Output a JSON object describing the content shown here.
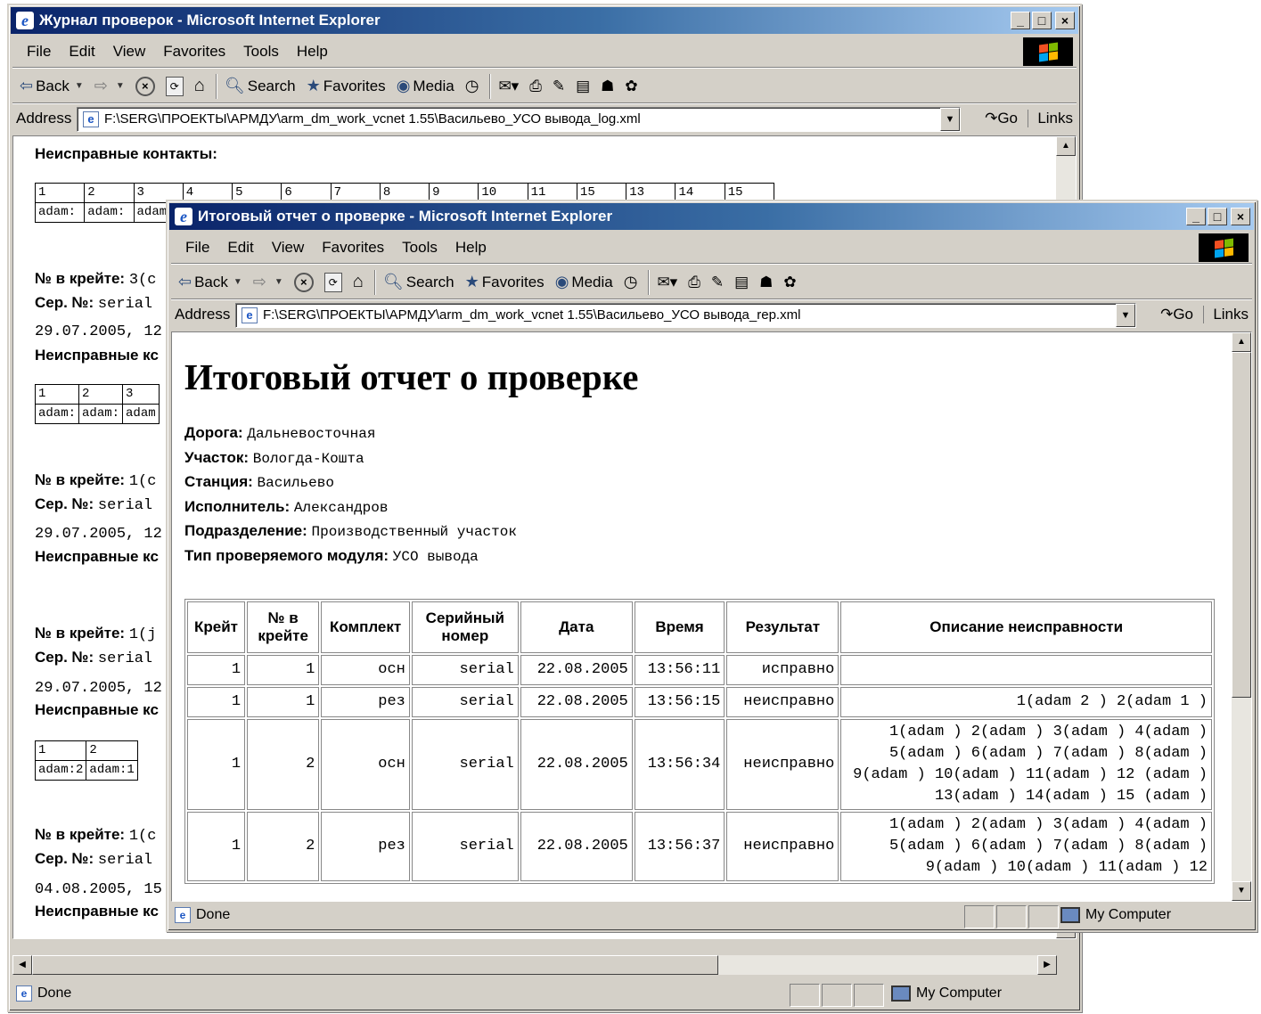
{
  "back_window": {
    "title": "Журнал проверок - Microsoft Internet Explorer",
    "menu": [
      "File",
      "Edit",
      "View",
      "Favorites",
      "Tools",
      "Help"
    ],
    "toolbar": {
      "back": "Back",
      "search": "Search",
      "favorites": "Favorites",
      "media": "Media"
    },
    "address_label": "Address",
    "address": "F:\\SERG\\ПРОЕКТЫ\\АРМДУ\\arm_dm_work_vcnet 1.55\\Васильево_УСО вывода_log.xml",
    "go": "Go",
    "links": "Links",
    "status": "Done",
    "zone": "My Computer",
    "log": {
      "faulty_label": "Неисправные контакты:",
      "first_table": {
        "nums": [
          "1",
          "2",
          "3",
          "4",
          "5",
          "6",
          "7",
          "8",
          "9",
          "10",
          "11",
          "15",
          "13",
          "14",
          "15"
        ],
        "vals": [
          "adam:",
          "adam:",
          "adam"
        ]
      },
      "blocks": [
        {
          "slot": "№ в крейте:",
          "slot_val": "3(c",
          "serial": "Сер. №:",
          "serial_val": "serial",
          "date": "29.07.2005, 12",
          "faulty": "Неисправные кс",
          "nums": [
            "1",
            "2",
            "3"
          ],
          "vals": [
            "adam:",
            "adam:",
            "adam"
          ]
        },
        {
          "slot": "№ в крейте:",
          "slot_val": "1(c",
          "serial": "Сер. №:",
          "serial_val": "serial",
          "date": "29.07.2005, 12",
          "faulty": "Неисправные кс"
        },
        {
          "slot": "№ в крейте:",
          "slot_val": "1(j",
          "serial": "Сер. №:",
          "serial_val": "serial",
          "date": "29.07.2005, 12",
          "faulty": "Неисправные кс",
          "nums": [
            "1",
            "2"
          ],
          "vals": [
            "adam:2",
            "adam:1"
          ]
        },
        {
          "slot": "№ в крейте:",
          "slot_val": "1(c",
          "serial": "Сер. №:",
          "serial_val": "serial",
          "date": "04.08.2005, 15",
          "faulty": "Неисправные кс"
        }
      ]
    }
  },
  "front_window": {
    "title": "Итоговый отчет о проверке - Microsoft Internet Explorer",
    "menu": [
      "File",
      "Edit",
      "View",
      "Favorites",
      "Tools",
      "Help"
    ],
    "toolbar": {
      "back": "Back",
      "search": "Search",
      "favorites": "Favorites",
      "media": "Media"
    },
    "address_label": "Address",
    "address": "F:\\SERG\\ПРОЕКТЫ\\АРМДУ\\arm_dm_work_vcnet 1.55\\Васильево_УСО вывода_rep.xml",
    "go": "Go",
    "links": "Links",
    "status": "Done",
    "zone": "My Computer",
    "report": {
      "heading": "Итоговый отчет о проверке",
      "meta": [
        {
          "key": "Дорога:",
          "value": "Дальневосточная"
        },
        {
          "key": "Участок:",
          "value": "Вологда-Кошта"
        },
        {
          "key": "Станция:",
          "value": "Васильево"
        },
        {
          "key": "Исполнитель:",
          "value": "Александров"
        },
        {
          "key": "Подразделение:",
          "value": "Производственный участок"
        },
        {
          "key": "Тип проверяемого модуля:",
          "value": "УСО вывода"
        }
      ],
      "columns": [
        "Крейт",
        "№ в крейте",
        "Комплект",
        "Серийный номер",
        "Дата",
        "Время",
        "Результат",
        "Описание неисправности"
      ],
      "rows": [
        {
          "crate": "1",
          "slot": "1",
          "set": "осн",
          "serial": "serial",
          "date": "22.08.2005",
          "time": "13:56:11",
          "result": "исправно",
          "desc": ""
        },
        {
          "crate": "1",
          "slot": "1",
          "set": "рез",
          "serial": "serial",
          "date": "22.08.2005",
          "time": "13:56:15",
          "result": "неисправно",
          "desc": "1(adam 2 ) 2(adam 1 )"
        },
        {
          "crate": "1",
          "slot": "2",
          "set": "осн",
          "serial": "serial",
          "date": "22.08.2005",
          "time": "13:56:34",
          "result": "неисправно",
          "desc": "1(adam ) 2(adam ) 3(adam ) 4(adam ) 5(adam ) 6(adam ) 7(adam ) 8(adam ) 9(adam ) 10(adam ) 11(adam ) 12 (adam ) 13(adam ) 14(adam ) 15 (adam )"
        },
        {
          "crate": "1",
          "slot": "2",
          "set": "рез",
          "serial": "serial",
          "date": "22.08.2005",
          "time": "13:56:37",
          "result": "неисправно",
          "desc": "1(adam ) 2(adam ) 3(adam ) 4(adam ) 5(adam ) 6(adam ) 7(adam ) 8(adam ) 9(adam ) 10(adam ) 11(adam ) 12"
        }
      ]
    }
  }
}
